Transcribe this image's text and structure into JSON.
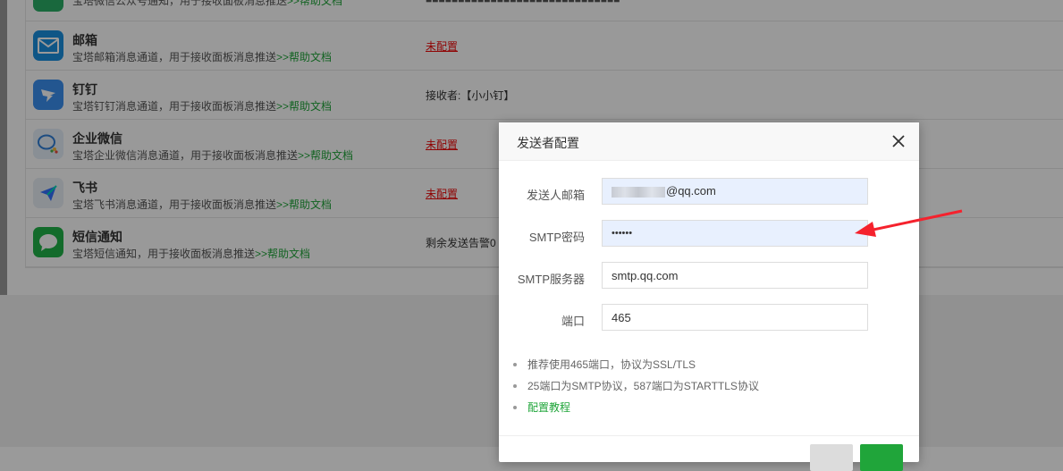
{
  "channels": [
    {
      "title": "",
      "desc": "宝塔微信公众号通知，用于接收面板消息推送",
      "help": ">>帮助文档",
      "status": "",
      "status_type": "text",
      "icon": "wechat-icon",
      "color": "#2aae67"
    },
    {
      "title": "邮箱",
      "desc": "宝塔邮箱消息通道，用于接收面板消息推送",
      "help": ">>帮助文档",
      "status": "未配置",
      "status_type": "unset",
      "icon": "mail-icon",
      "color": "#1a8fe0"
    },
    {
      "title": "钉钉",
      "desc": "宝塔钉钉消息通道，用于接收面板消息推送",
      "help": ">>帮助文档",
      "status": "接收者:【小小钉】",
      "status_type": "text",
      "icon": "dingtalk-icon",
      "color": "#3b8ff0"
    },
    {
      "title": "企业微信",
      "desc": "宝塔企业微信消息通道，用于接收面板消息推送",
      "help": ">>帮助文档",
      "status": "未配置",
      "status_type": "unset",
      "icon": "wecom-icon",
      "color": "#e4eef8"
    },
    {
      "title": "飞书",
      "desc": "宝塔飞书消息通道，用于接收面板消息推送",
      "help": ">>帮助文档",
      "status": "未配置",
      "status_type": "unset",
      "icon": "feishu-icon",
      "color": "#e8eef6"
    },
    {
      "title": "短信通知",
      "desc": "宝塔短信通知，用于接收面板消息推送",
      "help": ">>帮助文档",
      "status": "剩余发送告警0",
      "status_type": "text",
      "icon": "sms-icon",
      "color": "#21b348"
    }
  ],
  "dialog": {
    "title": "发送者配置",
    "close_icon": "close-icon",
    "fields": {
      "sender_email": {
        "label": "发送人邮箱",
        "value": "@qq.com"
      },
      "smtp_password": {
        "label": "SMTP密码",
        "value": "••••••"
      },
      "smtp_server": {
        "label": "SMTP服务器",
        "value": "smtp.qq.com"
      },
      "port": {
        "label": "端口",
        "value": "465"
      }
    },
    "tips": {
      "tip1": "推荐使用465端口，协议为SSL/TLS",
      "tip2": "25端口为SMTP协议，587端口为STARTTLS协议",
      "tip3": "配置教程"
    }
  },
  "colors": {
    "accent": "#20a53a",
    "unset": "#ef0808",
    "arrow": "#f5222d"
  }
}
